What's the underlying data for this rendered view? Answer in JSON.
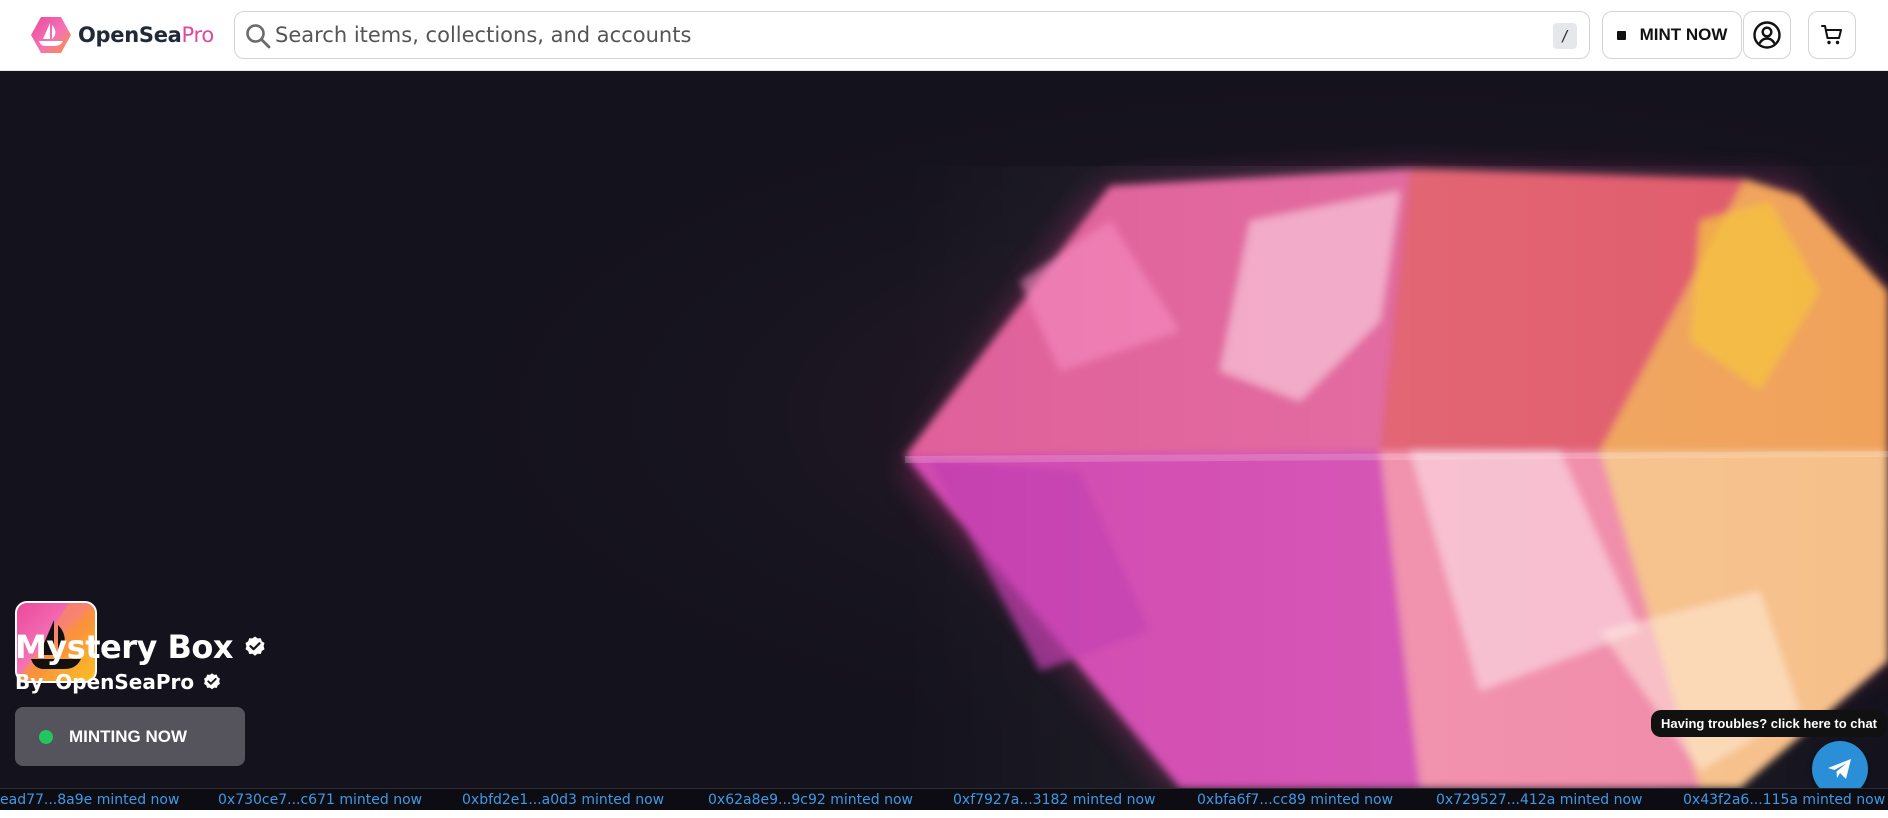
{
  "header": {
    "logo": {
      "brand": "OpenSea",
      "suffix": "Pro"
    },
    "search": {
      "placeholder": "Search items, collections, and accounts",
      "shortcut_key": "/"
    },
    "mint_now_label": "MINT NOW",
    "icons": {
      "search": "search-icon",
      "account": "user-circle-icon",
      "cart": "cart-icon"
    }
  },
  "hero": {
    "title": "Mystery Box",
    "by_label": "By",
    "creator": "OpenSeaPro",
    "status": "MINTING NOW",
    "status_color": "#22c55e"
  },
  "chat": {
    "tooltip": "Having troubles? click here to chat",
    "icon": "telegram-send-icon"
  },
  "ticker": {
    "items": [
      "ead77...8a9e minted now",
      "0x730ce7...c671 minted now",
      "0xbfd2e1...a0d3 minted now",
      "0x62a8e9...9c92 minted now",
      "0xf7927a...3182 minted now",
      "0xbfa6f7...cc89 minted now",
      "0x729527...412a minted now",
      "0x43f2a6...115a minted now"
    ]
  },
  "colors": {
    "brand_pink": "#e0479e",
    "hero_bg": "#14121c",
    "ticker_text": "#3f9ae6",
    "chat_button": "#2a8fd6"
  }
}
